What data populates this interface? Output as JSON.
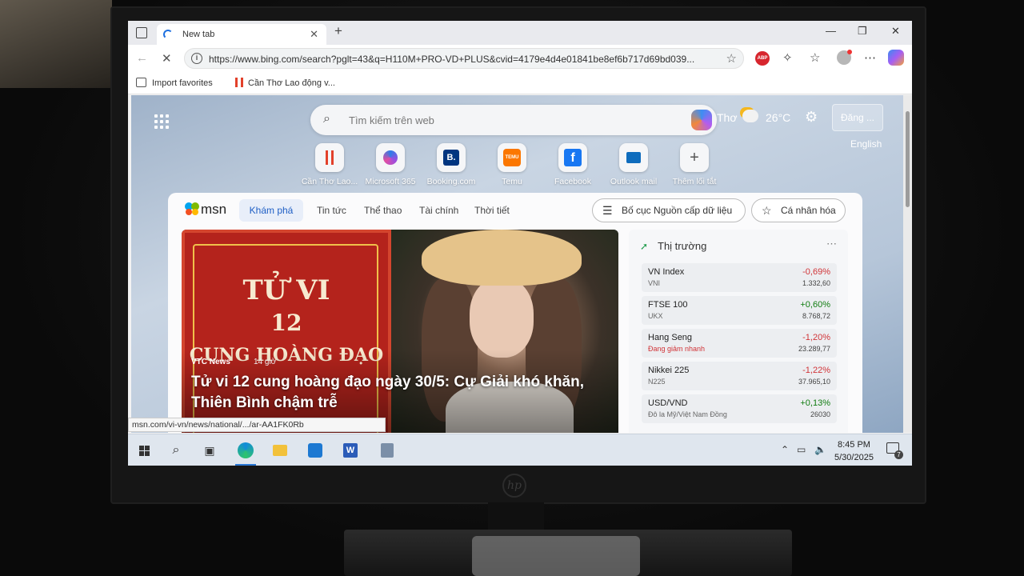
{
  "browser": {
    "tab_title": "New tab",
    "url": "https://www.bing.com/search?pglt=43&q=H110M+PRO-VD+PLUS&cvid=4179e4d4e01841be8ef6b717d69bd039...",
    "favorites": [
      {
        "label": "Import favorites"
      },
      {
        "label": "Cần Thơ Lao động v..."
      }
    ],
    "status_url": "msn.com/vi-vn/news/national/.../ar-AA1FK0Rb"
  },
  "newtab": {
    "search_placeholder": "Tìm kiếm trên web",
    "weather": {
      "city": "Thơ",
      "temp": "26°C"
    },
    "signin_label": "Đăng ...",
    "language_label": "English",
    "shortcuts": [
      {
        "label": "Cần Thơ Lao...",
        "icon": "lao-dong-icon"
      },
      {
        "label": "Microsoft 365",
        "icon": "m365-icon"
      },
      {
        "label": "Booking.com",
        "icon": "booking-icon"
      },
      {
        "label": "Temu",
        "icon": "temu-icon"
      },
      {
        "label": "Facebook",
        "icon": "facebook-icon"
      },
      {
        "label": "Outlook mail",
        "icon": "outlook-icon"
      },
      {
        "label": "Thêm lối tắt",
        "icon": "plus-icon"
      }
    ]
  },
  "msn": {
    "logo": "msn",
    "tabs": [
      "Khám phá",
      "Tin tức",
      "Thể thao",
      "Tài chính",
      "Thời tiết"
    ],
    "layout_button": "Bố cục Nguồn cấp dữ liệu",
    "personalize_button": "Cá nhân hóa",
    "hero": {
      "card_line1": "TỬ VI",
      "card_line2": "12",
      "card_line3": "CUNG HOÀNG ĐẠO",
      "source": "VTC News",
      "time": "14 giờ",
      "headline": "Tử vi 12 cung hoàng đạo ngày 30/5: Cự Giải khó khăn, Thiên Bình chậm trễ"
    },
    "market": {
      "title": "Thị trường",
      "rows": [
        {
          "name": "VN Index",
          "sub": "VNI",
          "change": "-0,69%",
          "value": "1.332,60",
          "color": "#d13438"
        },
        {
          "name": "FTSE 100",
          "sub": "UKX",
          "change": "+0,60%",
          "value": "8.768,72",
          "color": "#107c10"
        },
        {
          "name": "Hang Seng",
          "sub": "Đang giảm nhanh",
          "change": "-1,20%",
          "value": "23.289,77",
          "color": "#d13438"
        },
        {
          "name": "Nikkei 225",
          "sub": "N225",
          "change": "-1,22%",
          "value": "37.965,10",
          "color": "#d13438"
        },
        {
          "name": "USD/VND",
          "sub": "Đô la Mỹ/Việt Nam Đồng",
          "change": "+0,13%",
          "value": "26030",
          "color": "#107c10"
        }
      ]
    }
  },
  "taskbar": {
    "time": "8:45 PM",
    "date": "5/30/2025",
    "notifications": "7"
  }
}
